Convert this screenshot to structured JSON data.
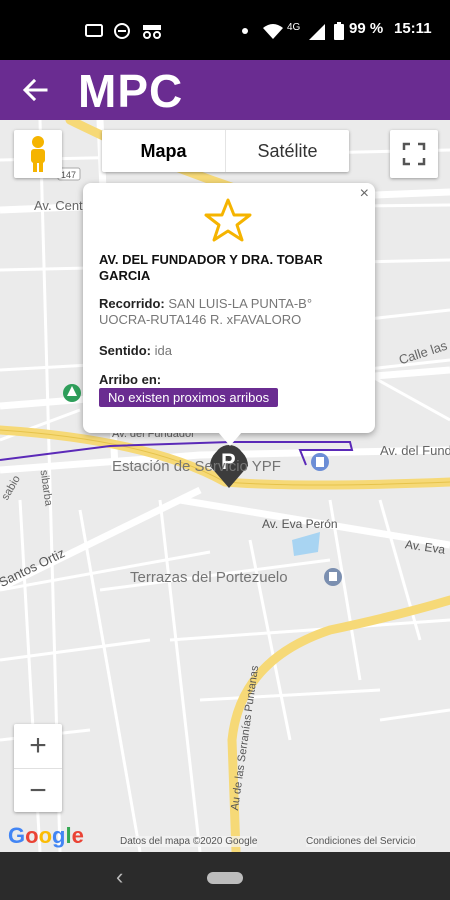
{
  "status_bar": {
    "signal_label": "4G",
    "battery": "99 %",
    "time": "15:11"
  },
  "app_bar": {
    "title": "MPC",
    "back_icon": "arrow-left-icon"
  },
  "map": {
    "type_options": [
      "Mapa",
      "Satélite"
    ],
    "selected_type": "Mapa",
    "zoom_in": "+",
    "zoom_out": "−",
    "road_badge": "147",
    "labels": {
      "av_centenario": "Av. Cent",
      "calle_las": "Calle las",
      "av_del_fundador_right": "Av. del Fundador",
      "av_del_fundador_left": "Av. del Fundador",
      "estacion": "Estación de Servicio YPF",
      "av_eva_peron": "Av. Eva Perón",
      "av_eva_right": "Av. Eva",
      "santos_ortiz": "Santos Ortiz",
      "sibarba": "sibarba",
      "sabio": "sabio",
      "terrazas": "Terrazas del Portezuelo",
      "serranias": "Au de las Serranías Puntanas"
    },
    "google": "Google",
    "attribution": "Datos del mapa ©2020 Google",
    "terms": "Condiciones del Servicio",
    "parking_marker": "P"
  },
  "info_window": {
    "close": "×",
    "stop_name": "AV. DEL FUNDADOR Y DRA. TOBAR GARCIA",
    "recorrido_label": "Recorrido:",
    "recorrido_value": "SAN LUIS-LA PUNTA-B° UOCRA-RUTA146 R. xFAVALORO",
    "sentido_label": "Sentido:",
    "sentido_value": "ida",
    "arribo_label": "Arribo en:",
    "arribo_value": "No existen proximos arribos"
  },
  "colors": {
    "brand": "#6a2c91",
    "star": "#f5b400",
    "route": "#5b2ab8"
  }
}
